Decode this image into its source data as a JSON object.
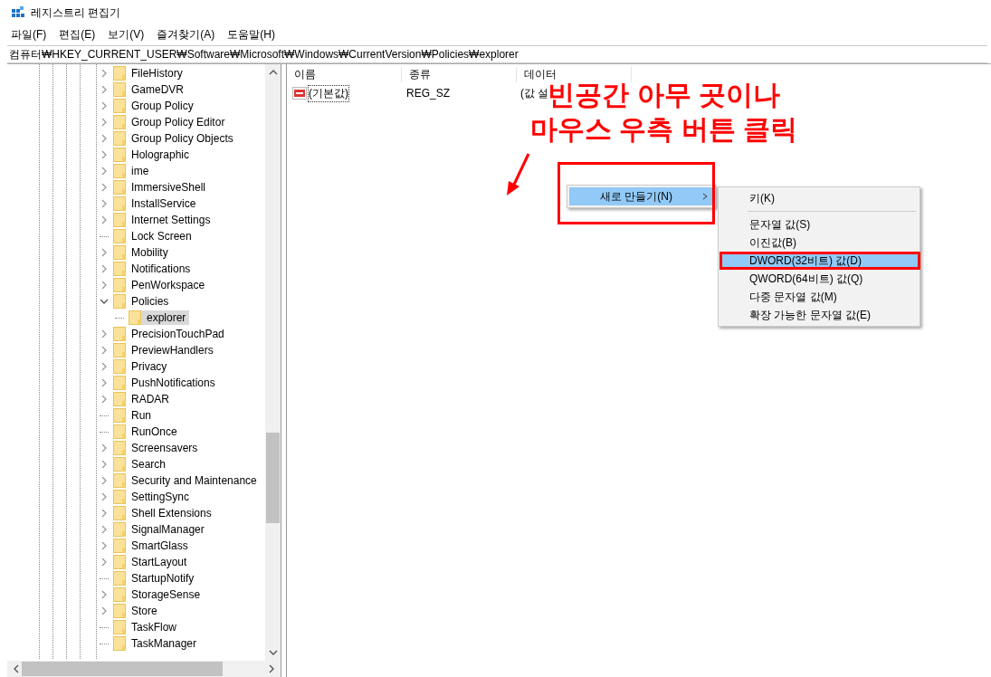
{
  "window": {
    "title": "레지스트리 편집기"
  },
  "menu_bar": [
    "파일(F)",
    "편집(E)",
    "보기(V)",
    "즐겨찾기(A)",
    "도움말(H)"
  ],
  "address_bar": "컴퓨터₩HKEY_CURRENT_USER₩Software₩Microsoft₩Windows₩CurrentVersion₩Policies₩explorer",
  "tree": [
    {
      "label": "FileHistory",
      "expandable": true,
      "expanded": false,
      "selected": false
    },
    {
      "label": "GameDVR",
      "expandable": true,
      "expanded": false,
      "selected": false
    },
    {
      "label": "Group Policy",
      "expandable": true,
      "expanded": false,
      "selected": false
    },
    {
      "label": "Group Policy Editor",
      "expandable": true,
      "expanded": false,
      "selected": false
    },
    {
      "label": "Group Policy Objects",
      "expandable": true,
      "expanded": false,
      "selected": false
    },
    {
      "label": "Holographic",
      "expandable": true,
      "expanded": false,
      "selected": false
    },
    {
      "label": "ime",
      "expandable": true,
      "expanded": false,
      "selected": false
    },
    {
      "label": "ImmersiveShell",
      "expandable": true,
      "expanded": false,
      "selected": false
    },
    {
      "label": "InstallService",
      "expandable": true,
      "expanded": false,
      "selected": false
    },
    {
      "label": "Internet Settings",
      "expandable": true,
      "expanded": false,
      "selected": false
    },
    {
      "label": "Lock Screen",
      "expandable": false,
      "selected": false
    },
    {
      "label": "Mobility",
      "expandable": true,
      "expanded": false,
      "selected": false
    },
    {
      "label": "Notifications",
      "expandable": true,
      "expanded": false,
      "selected": false
    },
    {
      "label": "PenWorkspace",
      "expandable": true,
      "expanded": false,
      "selected": false
    },
    {
      "label": "Policies",
      "expandable": true,
      "expanded": true,
      "selected": false,
      "children": [
        {
          "label": "explorer",
          "expandable": false,
          "selected": true
        }
      ]
    },
    {
      "label": "PrecisionTouchPad",
      "expandable": true,
      "expanded": false,
      "selected": false
    },
    {
      "label": "PreviewHandlers",
      "expandable": true,
      "expanded": false,
      "selected": false
    },
    {
      "label": "Privacy",
      "expandable": true,
      "expanded": false,
      "selected": false
    },
    {
      "label": "PushNotifications",
      "expandable": true,
      "expanded": false,
      "selected": false
    },
    {
      "label": "RADAR",
      "expandable": true,
      "expanded": false,
      "selected": false
    },
    {
      "label": "Run",
      "expandable": false,
      "selected": false
    },
    {
      "label": "RunOnce",
      "expandable": false,
      "selected": false
    },
    {
      "label": "Screensavers",
      "expandable": true,
      "expanded": false,
      "selected": false
    },
    {
      "label": "Search",
      "expandable": true,
      "expanded": false,
      "selected": false
    },
    {
      "label": "Security and Maintenance",
      "expandable": true,
      "expanded": false,
      "selected": false
    },
    {
      "label": "SettingSync",
      "expandable": true,
      "expanded": false,
      "selected": false
    },
    {
      "label": "Shell Extensions",
      "expandable": true,
      "expanded": false,
      "selected": false
    },
    {
      "label": "SignalManager",
      "expandable": true,
      "expanded": false,
      "selected": false
    },
    {
      "label": "SmartGlass",
      "expandable": true,
      "expanded": false,
      "selected": false
    },
    {
      "label": "StartLayout",
      "expandable": true,
      "expanded": false,
      "selected": false
    },
    {
      "label": "StartupNotify",
      "expandable": false,
      "selected": false
    },
    {
      "label": "StorageSense",
      "expandable": true,
      "expanded": false,
      "selected": false
    },
    {
      "label": "Store",
      "expandable": true,
      "expanded": false,
      "selected": false
    },
    {
      "label": "TaskFlow",
      "expandable": false,
      "selected": false
    },
    {
      "label": "TaskManager",
      "expandable": false,
      "selected": false
    }
  ],
  "list": {
    "columns": [
      "이름",
      "종류",
      "데이터"
    ],
    "rows": [
      {
        "name": "(기본값)",
        "type": "REG_SZ",
        "data": "(값 설",
        "selected": true
      }
    ]
  },
  "context_menu": [
    {
      "label": "새로 만들기(N)",
      "has_submenu": true,
      "selected": true
    }
  ],
  "submenu": [
    {
      "kind": "item",
      "label": "키(K)",
      "selected": false
    },
    {
      "kind": "separator"
    },
    {
      "kind": "item",
      "label": "문자열 값(S)",
      "selected": false
    },
    {
      "kind": "item",
      "label": "이진값(B)",
      "selected": false
    },
    {
      "kind": "item",
      "label": "DWORD(32비트) 값(D)",
      "selected": true
    },
    {
      "kind": "item",
      "label": "QWORD(64비트) 값(Q)",
      "selected": false
    },
    {
      "kind": "item",
      "label": "다중 문자열 값(M)",
      "selected": false
    },
    {
      "kind": "item",
      "label": "확장 가능한 문자열 값(E)",
      "selected": false
    }
  ],
  "annotation": [
    "빈공간 아무 곳이나",
    "마우스 우측 버튼 클릭"
  ]
}
